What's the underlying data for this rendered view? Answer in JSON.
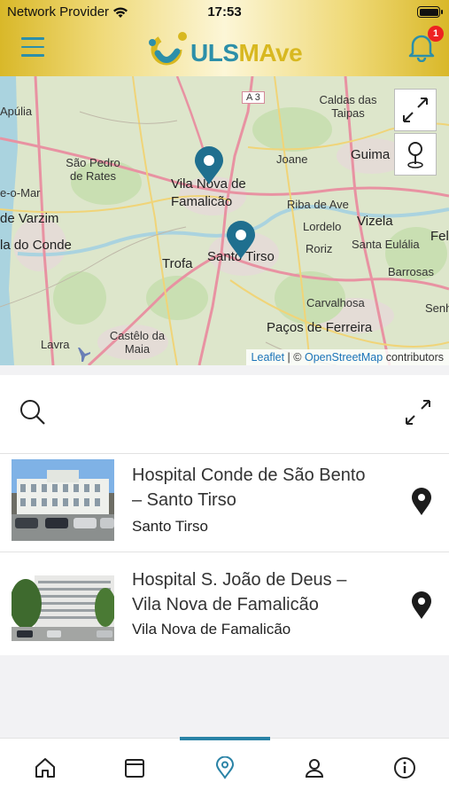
{
  "status_bar": {
    "carrier": "Network Provider",
    "time": "17:53"
  },
  "header": {
    "brand_prefix": "ULS",
    "brand_suffix": "MAve",
    "notification_count": "1"
  },
  "map": {
    "labels": [
      "Apúlia",
      "São Pedro de Rates",
      "Vila Nova de Famalicão",
      "Joane",
      "Caldas das Taipas",
      "Guima",
      "Riba de Ave",
      "Vizela",
      "Fel",
      "Lordelo",
      "Santa Eulália",
      "Santo Tirso",
      "Trofa",
      "Roriz",
      "Barrosas",
      "Carvalhosa",
      "Senh",
      "Paços de Ferreira",
      "Castêlo da Maia",
      "Lavra",
      "de Varzim",
      "la do Conde",
      "e-o-Mar",
      "A 3"
    ],
    "attribution": {
      "leaflet": "Leaflet",
      "separator": " | © ",
      "osm": "OpenStreetMap",
      "suffix": " contributors"
    },
    "controls": [
      "expand-icon",
      "locate-pin-icon"
    ],
    "markers": [
      "Hospital S. João de Deus",
      "Hospital Conde de São Bento"
    ]
  },
  "list": {
    "hospitals": [
      {
        "name_line1": "Hospital Conde de São Bento",
        "name_line2": "– Santo Tirso",
        "city": "Santo Tirso"
      },
      {
        "name_line1": "Hospital S. João de Deus –",
        "name_line2": "Vila Nova de Famalicão",
        "city": "Vila Nova de Famalicão"
      }
    ]
  },
  "tabbar": {
    "active": "map",
    "tabs": [
      "home",
      "calendar",
      "map",
      "profile",
      "info"
    ]
  },
  "colors": {
    "accent": "#2a83a6",
    "brand_yellow": "#d8b820",
    "pin_dark": "#1c1c1c",
    "map_marker": "#1f6f8f",
    "badge": "#e22222"
  }
}
